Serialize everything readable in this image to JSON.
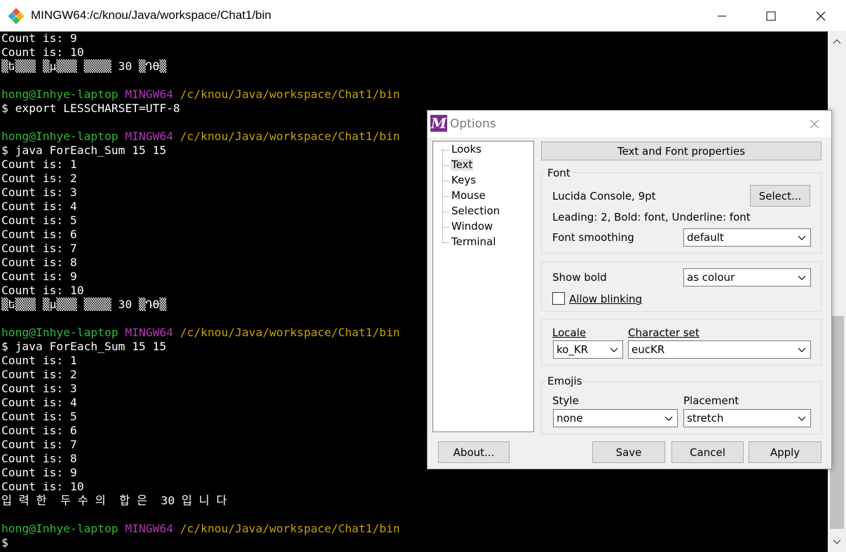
{
  "window": {
    "title": "MINGW64:/c/knou/Java/workspace/Chat1/bin"
  },
  "terminal": {
    "lines": [
      [
        {
          "t": "Count is: 9",
          "c": "white"
        }
      ],
      [
        {
          "t": "Count is: 10",
          "c": "white"
        }
      ],
      [
        {
          "t": "▒ե▒▒▒ ▒μ▒▒▒ ▒▒▒▒ 30 ▒Դϴ▒",
          "c": "white"
        }
      ],
      [],
      [
        {
          "t": "hong@Inhye-laptop ",
          "c": "green"
        },
        {
          "t": "MINGW64 ",
          "c": "purple"
        },
        {
          "t": "/c/knou/Java/workspace/Chat1/bin",
          "c": "yellow"
        }
      ],
      [
        {
          "t": "$ export LESSCHARSET=UTF-8",
          "c": "white"
        }
      ],
      [],
      [
        {
          "t": "hong@Inhye-laptop ",
          "c": "green"
        },
        {
          "t": "MINGW64 ",
          "c": "purple"
        },
        {
          "t": "/c/knou/Java/workspace/Chat1/bin",
          "c": "yellow"
        }
      ],
      [
        {
          "t": "$ java ForEach_Sum 15 15",
          "c": "white"
        }
      ],
      [
        {
          "t": "Count is: 1",
          "c": "white"
        }
      ],
      [
        {
          "t": "Count is: 2",
          "c": "white"
        }
      ],
      [
        {
          "t": "Count is: 3",
          "c": "white"
        }
      ],
      [
        {
          "t": "Count is: 4",
          "c": "white"
        }
      ],
      [
        {
          "t": "Count is: 5",
          "c": "white"
        }
      ],
      [
        {
          "t": "Count is: 6",
          "c": "white"
        }
      ],
      [
        {
          "t": "Count is: 7",
          "c": "white"
        }
      ],
      [
        {
          "t": "Count is: 8",
          "c": "white"
        }
      ],
      [
        {
          "t": "Count is: 9",
          "c": "white"
        }
      ],
      [
        {
          "t": "Count is: 10",
          "c": "white"
        }
      ],
      [
        {
          "t": "▒ե▒▒▒ ▒μ▒▒▒ ▒▒▒▒ 30 ▒Դϴ▒",
          "c": "white"
        }
      ],
      [],
      [
        {
          "t": "hong@Inhye-laptop ",
          "c": "green"
        },
        {
          "t": "MINGW64 ",
          "c": "purple"
        },
        {
          "t": "/c/knou/Java/workspace/Chat1/bin",
          "c": "yellow"
        }
      ],
      [
        {
          "t": "$ java ForEach_Sum 15 15",
          "c": "white"
        }
      ],
      [
        {
          "t": "Count is: 1",
          "c": "white"
        }
      ],
      [
        {
          "t": "Count is: 2",
          "c": "white"
        }
      ],
      [
        {
          "t": "Count is: 3",
          "c": "white"
        }
      ],
      [
        {
          "t": "Count is: 4",
          "c": "white"
        }
      ],
      [
        {
          "t": "Count is: 5",
          "c": "white"
        }
      ],
      [
        {
          "t": "Count is: 6",
          "c": "white"
        }
      ],
      [
        {
          "t": "Count is: 7",
          "c": "white"
        }
      ],
      [
        {
          "t": "Count is: 8",
          "c": "white"
        }
      ],
      [
        {
          "t": "Count is: 9",
          "c": "white"
        }
      ],
      [
        {
          "t": "Count is: 10",
          "c": "white"
        }
      ],
      [
        {
          "t": "입 력 한  두 수 의  합 은  30 입 니 다",
          "c": "white"
        }
      ],
      [],
      [
        {
          "t": "hong@Inhye-laptop ",
          "c": "green"
        },
        {
          "t": "MINGW64 ",
          "c": "purple"
        },
        {
          "t": "/c/knou/Java/workspace/Chat1/bin",
          "c": "yellow"
        }
      ],
      [
        {
          "t": "$",
          "c": "white"
        }
      ]
    ]
  },
  "colors": {
    "green": "#2fb934",
    "purple": "#b535b5",
    "yellow": "#c9a000",
    "white": "#ffffff",
    "dialog_icon": "#7a2a8c"
  },
  "dialog": {
    "icon_letter": "M",
    "title": "Options",
    "tree": [
      "Looks",
      "Text",
      "Keys",
      "Mouse",
      "Selection",
      "Window",
      "Terminal"
    ],
    "selected_tree_item": "Text",
    "header": "Text and Font properties",
    "font_group": {
      "title": "Font",
      "font_name": "Lucida Console, 9pt",
      "select_button": "Select...",
      "details": "Leading: 2, Bold: font, Underline: font",
      "smoothing_label": "Font smoothing",
      "smoothing_value": "default"
    },
    "bold_group": {
      "show_bold_label": "Show bold",
      "show_bold_value": "as colour",
      "allow_blinking_label": "Allow blinking",
      "allow_blinking_checked": false
    },
    "locale_group": {
      "locale_label": "Locale",
      "locale_value": "ko_KR",
      "charset_label": "Character set",
      "charset_value": "eucKR"
    },
    "emoji_group": {
      "title": "Emojis",
      "style_label": "Style",
      "style_value": "none",
      "placement_label": "Placement",
      "placement_value": "stretch"
    },
    "buttons": {
      "about": "About...",
      "save": "Save",
      "cancel": "Cancel",
      "apply": "Apply"
    }
  }
}
